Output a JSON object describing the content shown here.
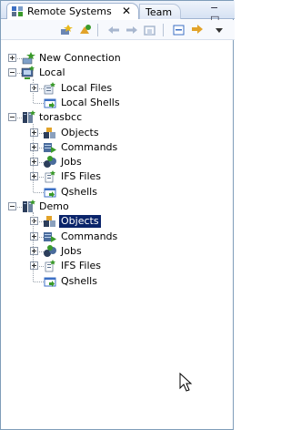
{
  "tabs": [
    {
      "label": "Remote Systems",
      "close": "✕"
    },
    {
      "label": "Team"
    }
  ],
  "window_buttons": "− □",
  "toolbar": [
    "new-connection",
    "refresh-filter",
    "back",
    "forward",
    "home",
    "collapse-all",
    "link-with-editor",
    "view-menu"
  ],
  "tree": [
    {
      "label": "New Connection",
      "level": 0,
      "expander": "plus",
      "icon": "new-connection-icon"
    },
    {
      "label": "Local",
      "level": 0,
      "expander": "minus",
      "icon": "local-system-icon"
    },
    {
      "label": "Local Files",
      "level": 1,
      "expander": "plus",
      "icon": "local-files-icon"
    },
    {
      "label": "Local Shells",
      "level": 1,
      "expander": "none",
      "icon": "shells-icon"
    },
    {
      "label": "torasbcc",
      "level": 0,
      "expander": "minus",
      "icon": "iseries-system-icon"
    },
    {
      "label": "Objects",
      "level": 1,
      "expander": "plus",
      "icon": "objects-icon"
    },
    {
      "label": "Commands",
      "level": 1,
      "expander": "plus",
      "icon": "commands-icon"
    },
    {
      "label": "Jobs",
      "level": 1,
      "expander": "plus",
      "icon": "jobs-icon"
    },
    {
      "label": "IFS Files",
      "level": 1,
      "expander": "plus",
      "icon": "ifs-files-icon"
    },
    {
      "label": "Qshells",
      "level": 1,
      "expander": "none",
      "icon": "shells-icon"
    },
    {
      "label": "Demo",
      "level": 0,
      "expander": "minus",
      "icon": "iseries-system-icon"
    },
    {
      "label": "Objects",
      "level": 1,
      "expander": "plus",
      "icon": "objects-icon",
      "selected": true
    },
    {
      "label": "Commands",
      "level": 1,
      "expander": "plus",
      "icon": "commands-icon"
    },
    {
      "label": "Jobs",
      "level": 1,
      "expander": "plus",
      "icon": "jobs-icon"
    },
    {
      "label": "IFS Files",
      "level": 1,
      "expander": "plus",
      "icon": "ifs-files-icon"
    },
    {
      "label": "Qshells",
      "level": 1,
      "expander": "none",
      "icon": "shells-icon"
    }
  ],
  "colors": {
    "selection": "#0a246a",
    "tab_border": "#9fb3d0",
    "accent_green": "#3a9a2a",
    "accent_blue": "#3b6fc4"
  }
}
